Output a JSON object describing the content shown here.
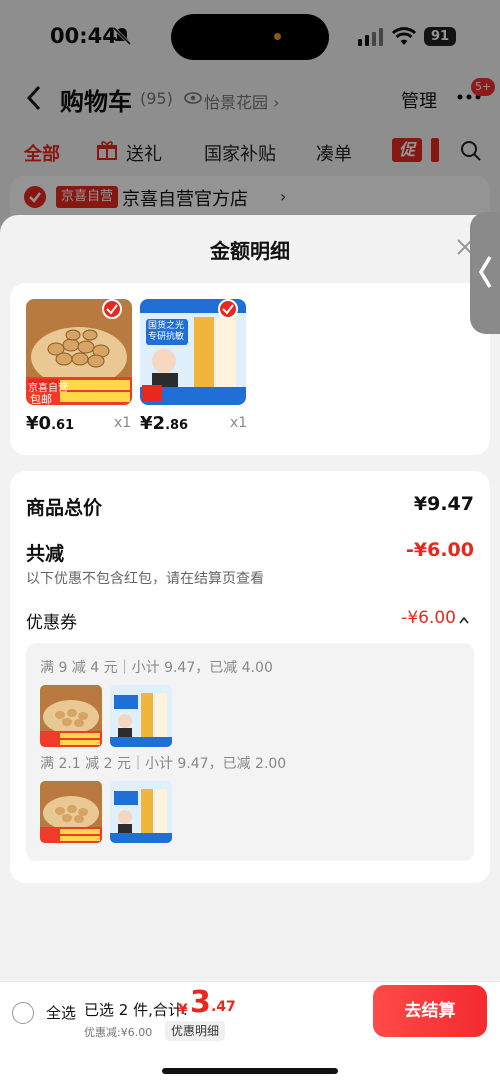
{
  "status_bar": {
    "time": "00:44",
    "battery": "91"
  },
  "header": {
    "back": "back",
    "title": "购物车",
    "count": "(95)",
    "location": "怡景花园",
    "location_chevron": "›",
    "manage": "管理",
    "more_badge": "5+"
  },
  "filter_tabs": [
    {
      "label": "全部",
      "active": true
    },
    {
      "label": "送礼"
    },
    {
      "label": "国家补贴"
    },
    {
      "label": "凑单"
    },
    {
      "label": "促"
    }
  ],
  "store": {
    "badge": "京喜自营",
    "name": "京喜自营官方店",
    "chevron": "›"
  },
  "sheet": {
    "title": "金额明细",
    "products": [
      {
        "name_icon": "peanut-product",
        "price_int": "¥0",
        "price_dec": ".61",
        "qty": "x1",
        "tag": "京喜自营",
        "tag2": "包邮"
      },
      {
        "name_icon": "toothpaste-product",
        "price_int": "¥2",
        "price_dec": ".86",
        "qty": "x1",
        "tag": "国货之光 专研抗敏"
      }
    ],
    "summary": {
      "total_label": "商品总价",
      "total_value": "¥9.47",
      "discount_label": "共减",
      "discount_value": "-¥6.00",
      "note": "以下优惠不包含红包，请在结算页查看",
      "coupon_label": "优惠券",
      "coupon_value": "-¥6.00"
    },
    "coupons": [
      {
        "line": "满 9 减 4 元｜小计 9.47，已减 4.00"
      },
      {
        "line": "满 2.1 减 2 元｜小计 9.47，已减 2.00"
      }
    ]
  },
  "bottom_bar": {
    "select_all": "全选",
    "selected": "已选 2 件,合计:",
    "total_yen": "¥",
    "total_int": "3",
    "total_dec": ".47",
    "discount": "优惠减:¥6.00",
    "detail": "优惠明细",
    "checkout": "去结算"
  },
  "colors": {
    "accent": "#e8281e",
    "sheet_bg": "#f2f2f2"
  }
}
